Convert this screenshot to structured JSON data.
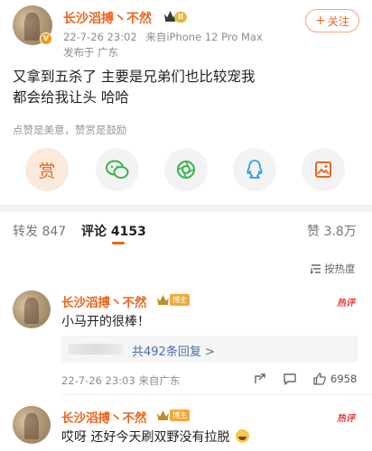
{
  "post": {
    "author_name": "长沙滔搏丶不然",
    "level_badge": "II",
    "timestamp": "22-7-26 23:02",
    "source": "来自iPhone 12 Pro Max",
    "location": "发布于 广东",
    "follow_label": "关注",
    "text_line1": "又拿到五杀了 主要是兄弟们也比较宠我",
    "text_line2": "都会给我让头 哈哈",
    "thanks_line": "点赞是美意，赞赏是鼓励",
    "reward_label": "赏"
  },
  "tabs": {
    "repost": "转发 847",
    "comments": "评论 4153",
    "likes": "赞 3.8万"
  },
  "sort_label": "按热度",
  "comments": [
    {
      "author_name": "长沙滔搏丶不然",
      "badge": "博主",
      "hot_tag": "热评",
      "text": "小马开的很棒！",
      "reply_link": "共492条回复 >",
      "timestamp": "22-7-26 23:03 来自广东",
      "like_count": "6958"
    },
    {
      "author_name": "长沙滔搏丶不然",
      "badge": "博主",
      "hot_tag": "热评",
      "text": "哎呀 还好今天刷双野没有拉脱"
    }
  ],
  "colors": {
    "accent": "#e8661f",
    "link": "#4a6fa5",
    "hot": "#e53c3c"
  }
}
